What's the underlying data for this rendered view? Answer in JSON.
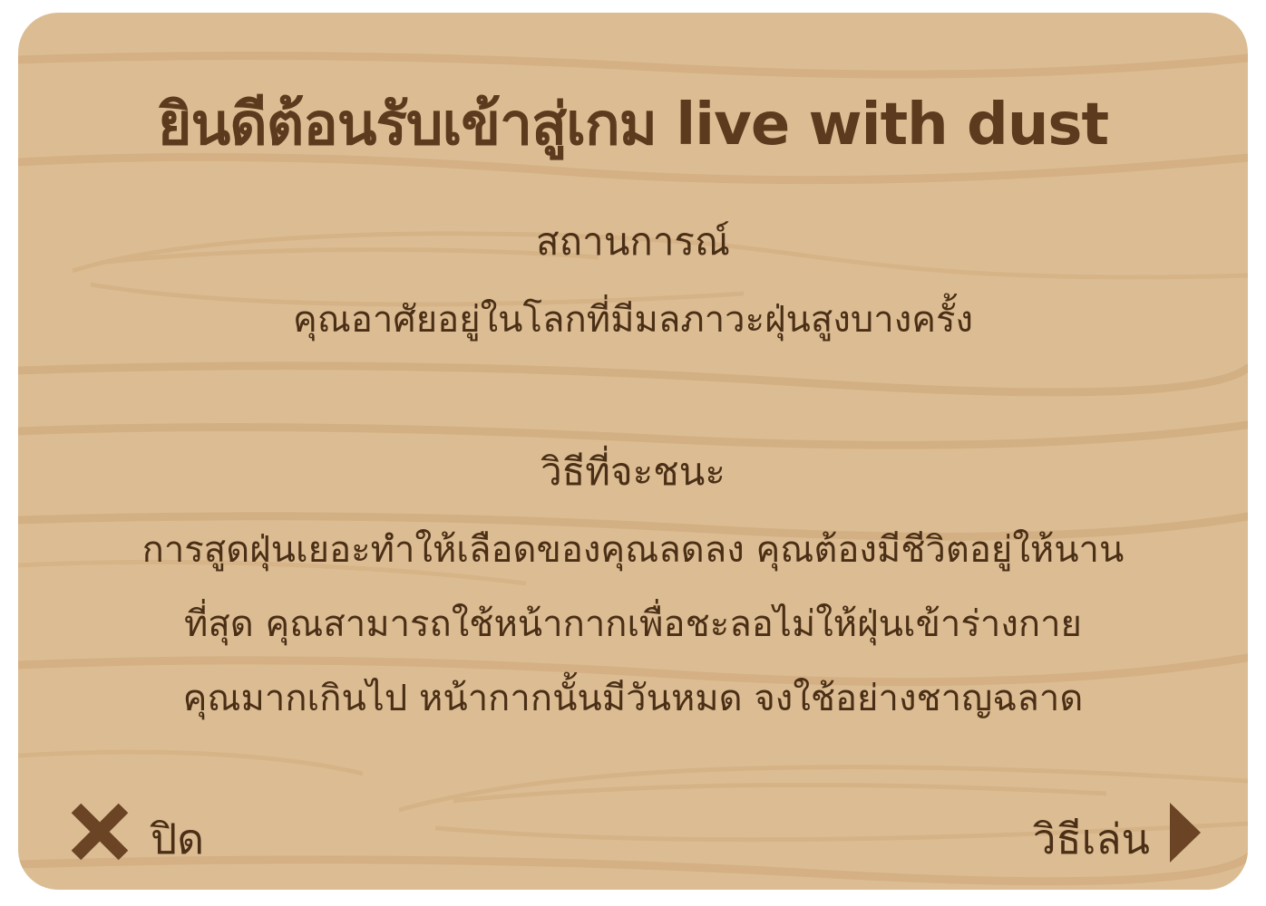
{
  "panel": {
    "title": "ยินดีต้อนรับเข้าสู่เกม live with dust",
    "scenario_heading": "สถานการณ์",
    "scenario_text": "คุณอาศัยอยู่ในโลกที่มีมลภาวะฝุ่นสูงบางครั้ง",
    "win_heading": "วิธีที่จะชนะ",
    "win_lines": [
      "การสูดฝุ่นเยอะทำให้เลือดของคุณลดลง คุณต้องมีชีวิตอยู่ให้นาน",
      "ที่สุด คุณสามารถใช้หน้ากากเพื่อชะลอไม่ให้ฝุ่นเข้าร่างกาย",
      "คุณมากเกินไป หน้ากากนั้นมีวันหมด จงใช้อย่างชาญฉลาด"
    ]
  },
  "buttons": {
    "close_label": "ปิด",
    "howto_label": "วิธีเล่น"
  },
  "icons": {
    "close": "close-x-icon",
    "next": "play-triangle-icon"
  },
  "colors": {
    "wood": "#dcbd93",
    "grain": "#d2ae81",
    "text": "#4a2f16",
    "title": "#5b3a1e",
    "icon": "#6a4424"
  }
}
